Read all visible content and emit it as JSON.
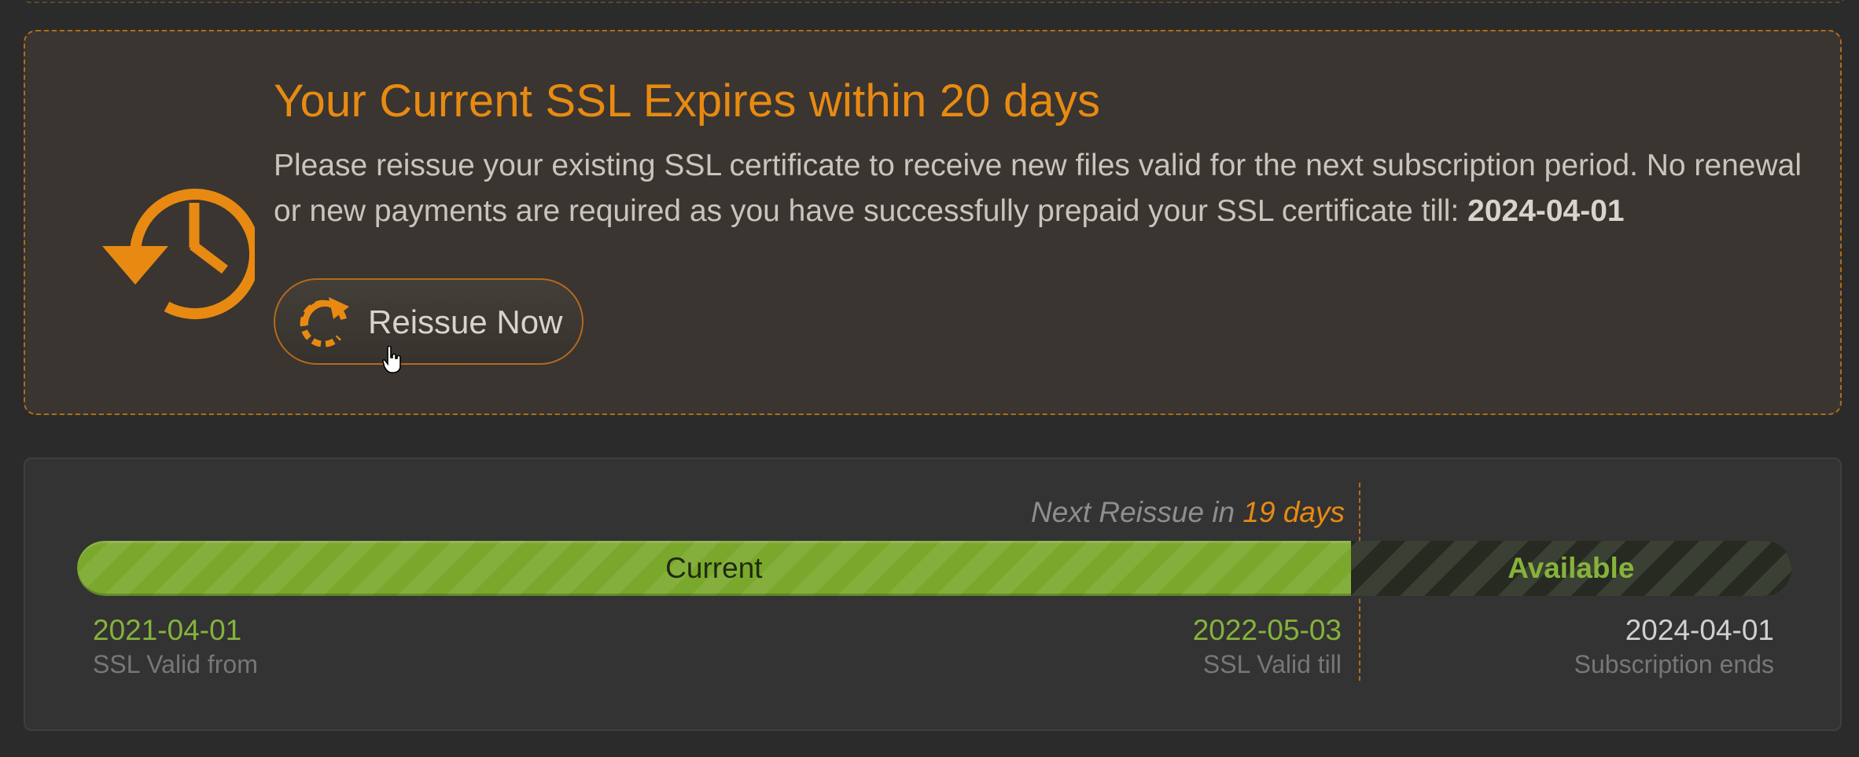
{
  "alert": {
    "title": "Your Current SSL Expires within 20 days",
    "message_before": "Please reissue your existing SSL certificate to receive new files valid for the next subscription period. No renewal or new payments are required as you have successfully prepaid your SSL certificate till: ",
    "message_date": "2024-04-01",
    "icon": "clock-history-icon",
    "button_label": "Reissue Now",
    "button_icon": "refresh-icon"
  },
  "timeline": {
    "next_reissue_prefix": "Next Reissue in ",
    "next_reissue_days": "19 days",
    "current_fraction": 0.743,
    "segments": {
      "current_label": "Current",
      "available_label": "Available"
    },
    "start": {
      "date": "2021-04-01",
      "caption": "SSL Valid from"
    },
    "valid_till": {
      "date": "2022-05-03",
      "caption": "SSL Valid till"
    },
    "end": {
      "date": "2024-04-01",
      "caption": "Subscription ends"
    }
  },
  "colors": {
    "accent": "#e88a12",
    "progress_green": "#7aa82c",
    "date_green": "#86b33a",
    "background": "#2b2b2b",
    "panel": "#3a3530"
  }
}
